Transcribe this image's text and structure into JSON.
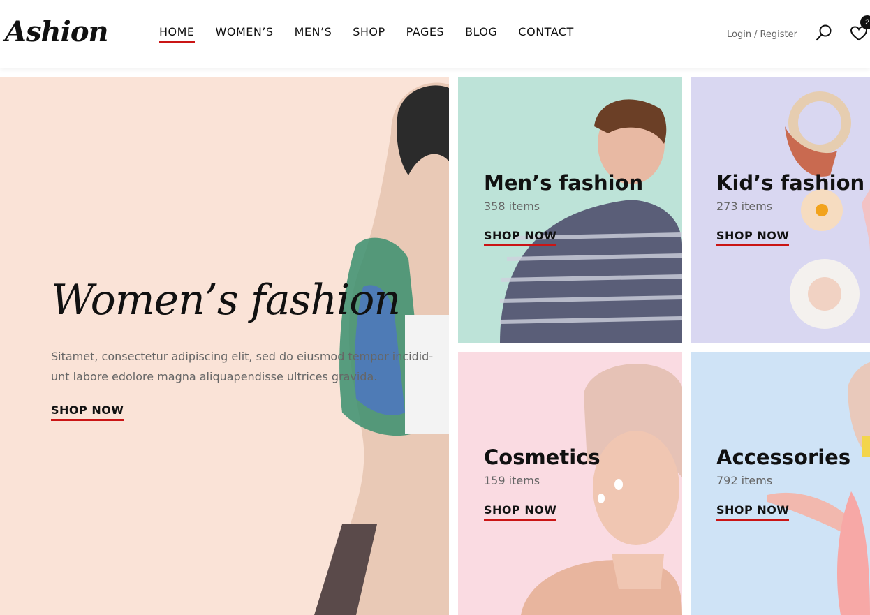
{
  "header": {
    "logo": "Ashion",
    "nav": [
      {
        "label": "HOME",
        "active": true
      },
      {
        "label": "WOMEN’S",
        "active": false
      },
      {
        "label": "MEN’S",
        "active": false
      },
      {
        "label": "SHOP",
        "active": false
      },
      {
        "label": "PAGES",
        "active": false
      },
      {
        "label": "BLOG",
        "active": false
      },
      {
        "label": "CONTACT",
        "active": false
      }
    ],
    "login_label": "Login",
    "separator": "/",
    "register_label": "Register",
    "wishlist_count": "2",
    "icons": [
      "search-icon",
      "heart-icon"
    ]
  },
  "hero": {
    "title": "Women’s fashion",
    "text": "Sitamet, consectetur adipiscing elit, sed do eiusmod tempor incidid-unt labore edolore magna aliquapendisse ultrices gravida.",
    "cta": "SHOP NOW"
  },
  "categories": [
    {
      "title": "Men’s fashion",
      "count": "358 items",
      "cta": "SHOP NOW"
    },
    {
      "title": "Kid’s fashion",
      "count": "273 items",
      "cta": "SHOP NOW"
    },
    {
      "title": "Cosmetics",
      "count": "159 items",
      "cta": "SHOP NOW"
    },
    {
      "title": "Accessories",
      "count": "792 items",
      "cta": "SHOP NOW"
    }
  ],
  "colors": {
    "accent": "#ca1515",
    "hero_bg": "#fae3d7",
    "mens_bg": "#bde3d8",
    "kids_bg": "#d9d7f1",
    "cosmetics_bg": "#fadbe2",
    "accessories_bg": "#cfe3f6"
  }
}
